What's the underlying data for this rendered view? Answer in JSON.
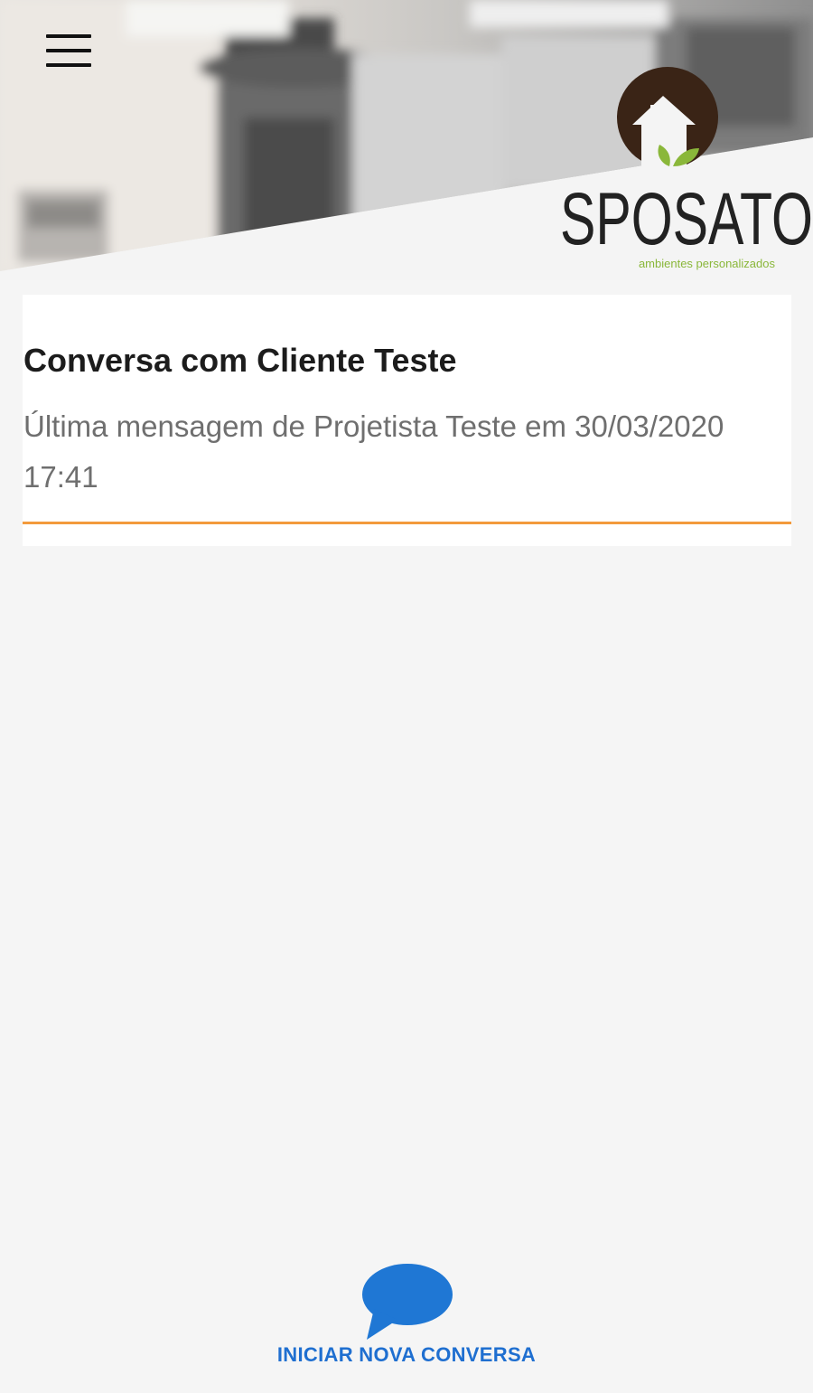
{
  "app": {
    "brand_name": "SPOSATO",
    "brand_tagline": "ambientes personalizados"
  },
  "header": {
    "menu_icon": "hamburger-menu-icon"
  },
  "conversations": [
    {
      "title": "Conversa com Cliente Teste",
      "subtitle": "Última mensagem de Projetista Teste em 30/03/2020 17:41"
    }
  ],
  "footer": {
    "new_conversation_icon": "chat-bubble-icon",
    "new_conversation_label": "INICIAR NOVA CONVERSA"
  },
  "colors": {
    "background": "#f5f5f5",
    "card_underline": "#f39a3c",
    "action_blue": "#1f6fd0",
    "logo_brown": "#3a2416",
    "logo_green": "#8ab73a"
  }
}
